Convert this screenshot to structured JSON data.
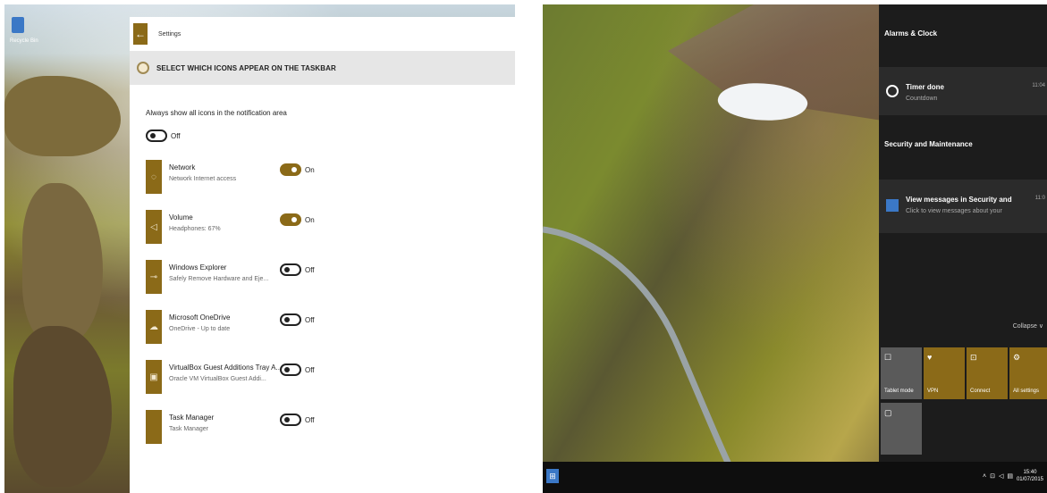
{
  "left": {
    "desktop_icon_label": "Recycle Bin",
    "settings": {
      "back_glyph": "←",
      "window_title": "Settings",
      "header": "SELECT WHICH ICONS APPEAR ON THE TASKBAR",
      "always_show_label": "Always show all icons in the notification area",
      "always_show_state": "Off",
      "rows": [
        {
          "name": "Network",
          "sub": "Network Internet access",
          "state": "On",
          "icon": "network-icon"
        },
        {
          "name": "Volume",
          "sub": "Headphones: 67%",
          "state": "On",
          "icon": "volume-icon"
        },
        {
          "name": "Windows Explorer",
          "sub": "Safely Remove Hardware and Eje...",
          "state": "Off",
          "icon": "usb-icon"
        },
        {
          "name": "Microsoft OneDrive",
          "sub": "OneDrive - Up to date",
          "state": "Off",
          "icon": "cloud-icon"
        },
        {
          "name": "VirtualBox Guest Additions Tray A...",
          "sub": "Oracle VM VirtualBox Guest Addi...",
          "state": "Off",
          "icon": "virtualbox-icon"
        },
        {
          "name": "Task Manager",
          "sub": "Task Manager",
          "state": "Off",
          "icon": "task-manager-icon"
        }
      ]
    }
  },
  "right": {
    "action_center": {
      "section_alarms": "Alarms & Clock",
      "timer_title": "Timer done",
      "timer_sub": "Countdown",
      "timer_time": "11:04",
      "section_security": "Security and Maintenance",
      "security_title": "View messages in Security and",
      "security_sub": "Click to view messages about your",
      "security_time": "11:0",
      "collapse": "Collapse ∨",
      "quick_actions": [
        {
          "label": "Tablet mode",
          "icon": "tablet-icon",
          "active": false
        },
        {
          "label": "VPN",
          "icon": "vpn-icon",
          "active": true
        },
        {
          "label": "Connect",
          "icon": "connect-icon",
          "active": true
        },
        {
          "label": "All settings",
          "icon": "gear-icon",
          "active": true
        },
        {
          "label": "",
          "icon": "note-icon",
          "active": false
        }
      ]
    },
    "taskbar": {
      "start_glyph": "⊞",
      "time": "15:40",
      "date": "01/07/2015"
    }
  },
  "colors": {
    "accent": "#8b6a18",
    "action_center_bg": "#1c1c1c",
    "taskbar_bg": "#0e0e0e"
  }
}
